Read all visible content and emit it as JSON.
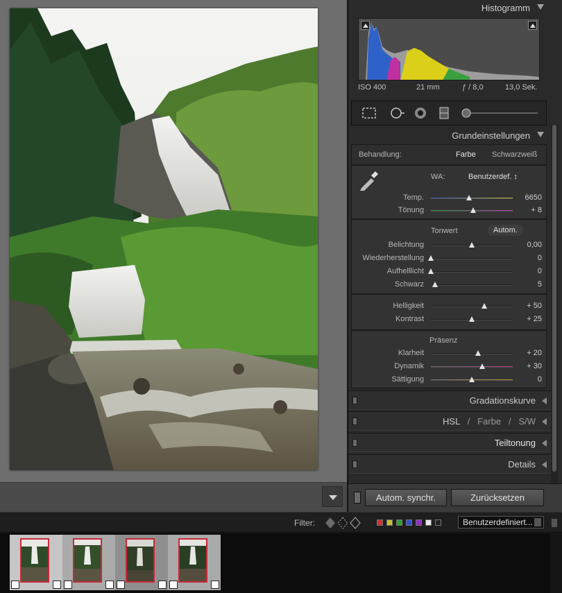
{
  "histogram": {
    "title": "Histogramm",
    "iso": "ISO 400",
    "focal": "21 mm",
    "aperture": "ƒ / 8,0",
    "shutter": "13,0 Sek."
  },
  "basic": {
    "title": "Grundeinstellungen",
    "treatment_label": "Behandlung:",
    "treatment_color": "Farbe",
    "treatment_bw": "Schwarzweiß",
    "wb_label": "WA:",
    "wb_value": "Benutzerdef. ↕",
    "temp_label": "Temp.",
    "temp_value": "6650",
    "temp_pos": 0.47,
    "tint_label": "Tönung",
    "tint_value": "+ 8",
    "tint_pos": 0.52,
    "tone_title": "Tonwert",
    "auto_label": "Autom.",
    "exposure_label": "Belichtung",
    "exposure_value": "0,00",
    "exposure_pos": 0.5,
    "recovery_label": "Wiederherstellung",
    "recovery_value": "0",
    "recovery_pos": 0.0,
    "fill_label": "Aufhelllicht",
    "fill_value": "0",
    "fill_pos": 0.0,
    "blacks_label": "Schwarz",
    "blacks_value": "5",
    "blacks_pos": 0.05,
    "brightness_label": "Helligkeit",
    "brightness_value": "+ 50",
    "brightness_pos": 0.65,
    "contrast_label": "Kontrast",
    "contrast_value": "+ 25",
    "contrast_pos": 0.5,
    "presence_title": "Präsenz",
    "clarity_label": "Klarheit",
    "clarity_value": "+ 20",
    "clarity_pos": 0.58,
    "vibrance_label": "Dynamik",
    "vibrance_value": "+ 30",
    "vibrance_pos": 0.63,
    "saturation_label": "Sättigung",
    "saturation_value": "0",
    "saturation_pos": 0.5
  },
  "panels": {
    "tone_curve": "Gradationskurve",
    "hsl": "HSL",
    "hsl_sep1": "/",
    "color": "Farbe",
    "hsl_sep2": "/",
    "bw": "S/W",
    "split_toning": "Teiltonung",
    "details": "Details"
  },
  "buttons": {
    "auto_sync": "Autom. synchr.",
    "reset": "Zurücksetzen"
  },
  "filter": {
    "label": "Filter:",
    "preset": "Benutzerdefiniert...",
    "colors": [
      "#d03030",
      "#c8c030",
      "#30a030",
      "#3050d0",
      "#9030c0",
      "#e8e8e8",
      "#222222"
    ]
  }
}
